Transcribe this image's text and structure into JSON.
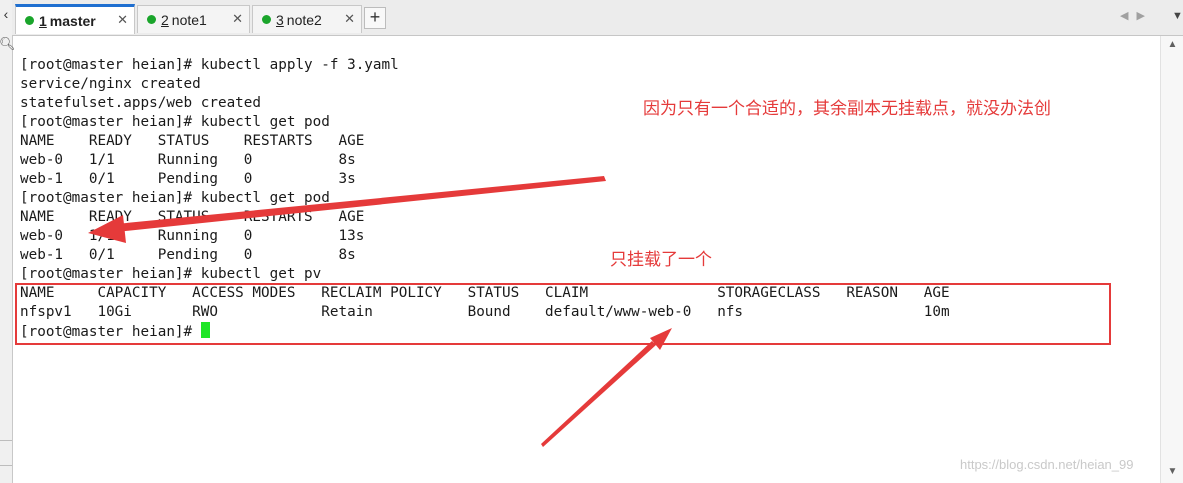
{
  "tabs": [
    {
      "num": "1",
      "label": "master",
      "active": true
    },
    {
      "num": "2",
      "label": "note1",
      "active": false
    },
    {
      "num": "3",
      "label": "note2",
      "active": false
    }
  ],
  "tab_close_glyph": "✕",
  "add_tab_glyph": "+",
  "nav_arrows": "◀▶",
  "dropdown_glyph": "▼",
  "terminal": {
    "lines": [
      "",
      "[root@master heian]# kubectl apply -f 3.yaml",
      "service/nginx created",
      "statefulset.apps/web created",
      "[root@master heian]# kubectl get pod",
      "NAME    READY   STATUS    RESTARTS   AGE",
      "web-0   1/1     Running   0          8s",
      "web-1   0/1     Pending   0          3s",
      "[root@master heian]# kubectl get pod",
      "NAME    READY   STATUS    RESTARTS   AGE",
      "web-0   1/1     Running   0          13s",
      "web-1   0/1     Pending   0          8s",
      "[root@master heian]# kubectl get pv",
      "NAME     CAPACITY   ACCESS MODES   RECLAIM POLICY   STATUS   CLAIM               STORAGECLASS   REASON   AGE",
      "nfspv1   10Gi       RWO            Retain           Bound    default/www-web-0   nfs                     10m"
    ],
    "prompt": "[root@master heian]# "
  },
  "annotations": {
    "note_1": "因为只有一个合适的，其余副本无挂载点，就没办法创",
    "note_2": "只挂载了一个",
    "color": "#e53a3a"
  },
  "watermark": "https://blog.csdn.net/heian_99",
  "colors": {
    "accent_tab": "#1f6fd0",
    "status_dot": "#1aa52b",
    "cursor": "#1ee627"
  }
}
